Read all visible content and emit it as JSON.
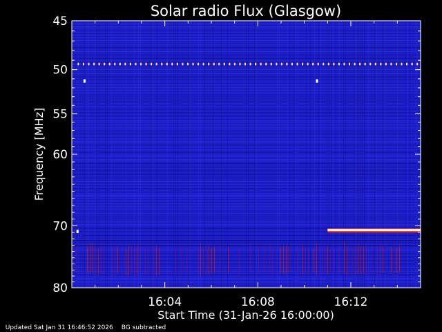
{
  "chart_data": {
    "type": "heatmap",
    "title": "Solar radio Flux (Glasgow)",
    "xlabel": "Start Time (31-Jan-26 16:00:00)",
    "ylabel": "Frequency [MHz]",
    "x_ticks": [
      "16:04",
      "16:08",
      "16:12"
    ],
    "x_tick_minutes": [
      4,
      8,
      12
    ],
    "xlim_minutes": [
      0,
      15
    ],
    "y_ticks": [
      45,
      50,
      55,
      60,
      70,
      80
    ],
    "ylim": [
      45,
      80
    ],
    "y_scale": "log",
    "colors": {
      "background": "#000000",
      "plot_base": "#1f1fc8",
      "interference": "#ffffff",
      "hot": "#ff3010"
    },
    "interference_bands": [
      {
        "frequency_mhz": 49.4,
        "start_min": 0.25,
        "end_min": 15,
        "pattern": "dotted"
      },
      {
        "frequency_mhz": 70.7,
        "start_min": 11.0,
        "end_min": 15,
        "pattern": "solid"
      }
    ],
    "grid": false
  },
  "footer": {
    "updated": "Updated Sat Jan 31 16:46:52 2026",
    "note": "BG subtracted"
  }
}
